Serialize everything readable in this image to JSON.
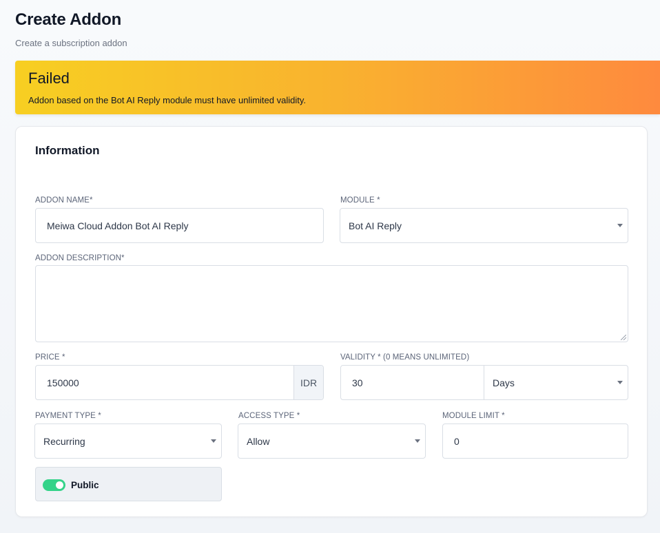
{
  "header": {
    "title": "Create Addon",
    "subtitle": "Create a subscription addon"
  },
  "alert": {
    "title": "Failed",
    "message": "Addon based on the Bot AI Reply module must have unlimited validity.",
    "colors": {
      "start": "#f7cf22",
      "end": "#fe8a3e"
    }
  },
  "form": {
    "section_title": "Information",
    "addon_name": {
      "label": "ADDON NAME*",
      "value": "Meiwa Cloud Addon Bot AI Reply"
    },
    "module": {
      "label": "MODULE *",
      "value": "Bot AI Reply"
    },
    "description": {
      "label": "ADDON DESCRIPTION*",
      "value": ""
    },
    "price": {
      "label": "PRICE *",
      "value": "150000",
      "currency": "IDR"
    },
    "validity": {
      "label": "VALIDITY * (0 MEANS UNLIMITED)",
      "value": "30",
      "unit": "Days"
    },
    "payment_type": {
      "label": "PAYMENT TYPE *",
      "value": "Recurring"
    },
    "access_type": {
      "label": "ACCESS TYPE *",
      "value": "Allow"
    },
    "module_limit": {
      "label": "MODULE LIMIT *",
      "value": "0"
    },
    "public_toggle": {
      "label": "Public",
      "on": true,
      "color": "#34d389"
    }
  },
  "icons": {
    "dropdown": "chevron-down-icon",
    "resize": "resize-grip-icon"
  }
}
